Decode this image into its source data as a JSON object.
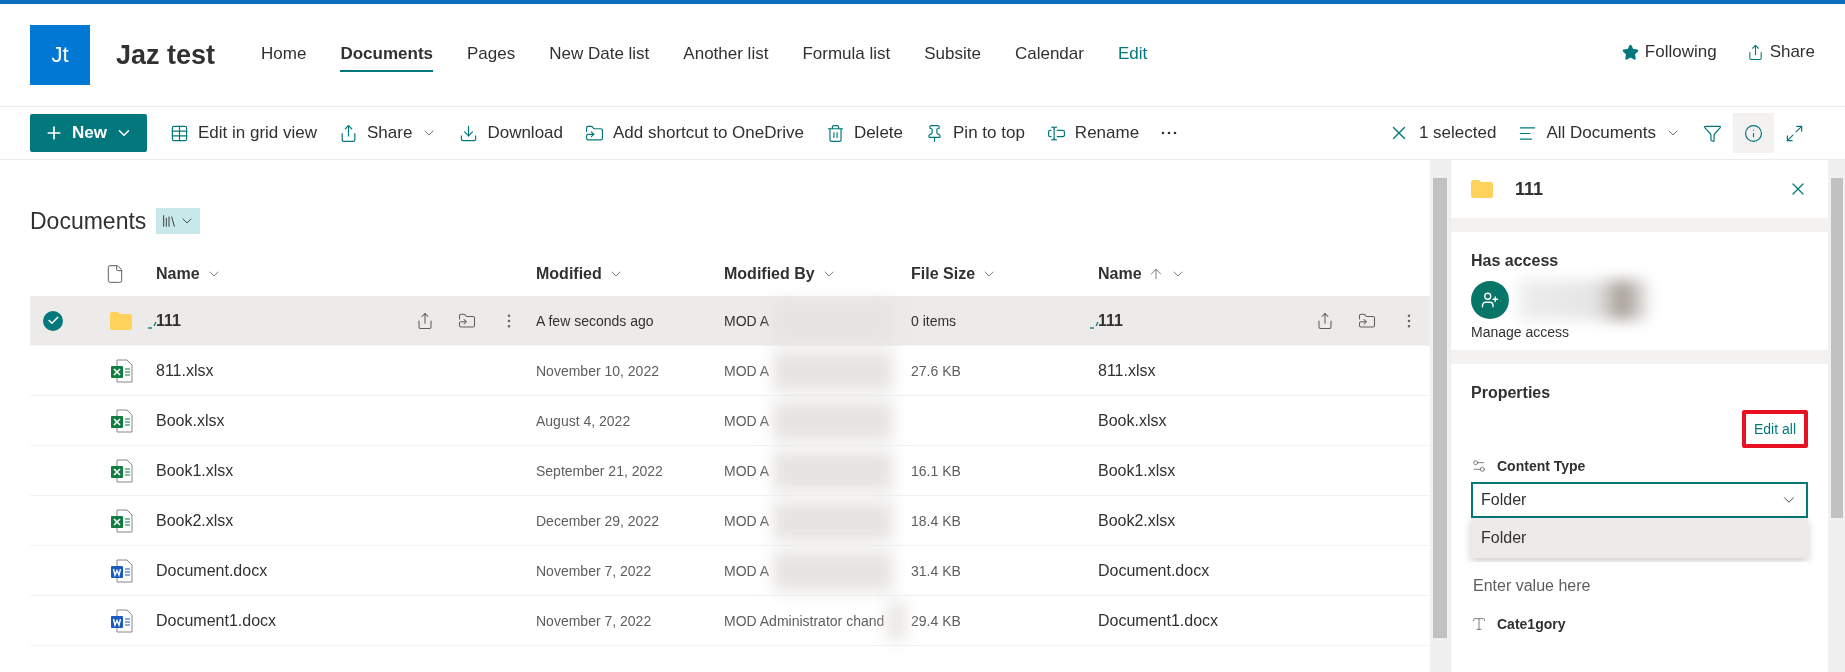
{
  "site": {
    "logo": "Jt",
    "title": "Jaz test"
  },
  "nav": [
    {
      "label": "Home",
      "kind": "tab",
      "selected": false
    },
    {
      "label": "Documents",
      "kind": "tab",
      "selected": true
    },
    {
      "label": "Pages",
      "kind": "tab",
      "selected": false
    },
    {
      "label": "New Date list",
      "kind": "tab",
      "selected": false
    },
    {
      "label": "Another list",
      "kind": "tab",
      "selected": false
    },
    {
      "label": "Formula list",
      "kind": "tab",
      "selected": false
    },
    {
      "label": "Subsite",
      "kind": "tab",
      "selected": false
    },
    {
      "label": "Calendar",
      "kind": "tab",
      "selected": false
    },
    {
      "label": "Edit",
      "kind": "edit",
      "selected": false
    }
  ],
  "header_actions": [
    {
      "label": "Following",
      "kind": "following"
    },
    {
      "label": "Share",
      "kind": "share"
    }
  ],
  "commands": [
    {
      "label": "New",
      "kind": "new",
      "dropdown": true
    },
    {
      "label": "Edit in grid view",
      "kind": "grid",
      "dropdown": false
    },
    {
      "label": "Share",
      "kind": "share",
      "dropdown": true
    },
    {
      "label": "Download",
      "kind": "download",
      "dropdown": false
    },
    {
      "label": "Add shortcut to OneDrive",
      "kind": "shortcut",
      "dropdown": false
    },
    {
      "label": "Delete",
      "kind": "delete",
      "dropdown": false
    },
    {
      "label": "Pin to top",
      "kind": "pin",
      "dropdown": false
    },
    {
      "label": "Rename",
      "kind": "rename",
      "dropdown": false
    },
    {
      "kind": "more",
      "dropdown": false
    }
  ],
  "commands_right": [
    {
      "label": "1 selected",
      "kind": "clear",
      "dropdown": false,
      "selected": false
    },
    {
      "label": "All Documents",
      "kind": "view",
      "dropdown": true,
      "selected": false
    },
    {
      "kind": "filter",
      "dropdown": false,
      "selected": false
    },
    {
      "kind": "info",
      "dropdown": false,
      "selected": true
    },
    {
      "kind": "expand",
      "dropdown": false,
      "selected": false
    }
  ],
  "library": {
    "title": "Documents"
  },
  "table": {
    "columns": [
      {
        "kind": "type"
      },
      {
        "label": "Name",
        "kind": "text",
        "sorted_ascending": false
      },
      {
        "label": "Modified",
        "kind": "text",
        "sorted_ascending": false
      },
      {
        "label": "Modified By",
        "kind": "text",
        "sorted_ascending": false
      },
      {
        "label": "File Size",
        "kind": "text",
        "sorted_ascending": false
      },
      {
        "label": "Name",
        "kind": "text",
        "sorted_ascending": true
      }
    ],
    "rows": [
      {
        "kind": "folder",
        "name": "111",
        "new": true,
        "selected": true,
        "modified": "A few seconds ago",
        "modified_by": "MOD A",
        "file_size": "0 items",
        "name_2": "111"
      },
      {
        "kind": "excel",
        "name": "811.xlsx",
        "new": false,
        "selected": false,
        "modified": "November 10, 2022",
        "modified_by": "MOD A",
        "file_size": "27.6 KB",
        "name_2": "811.xlsx"
      },
      {
        "kind": "excel",
        "name": "Book.xlsx",
        "new": false,
        "selected": false,
        "modified": "August 4, 2022",
        "modified_by": "MOD A",
        "name_2": "Book.xlsx"
      },
      {
        "kind": "excel",
        "name": "Book1.xlsx",
        "new": false,
        "selected": false,
        "modified": "September 21, 2022",
        "modified_by": "MOD A",
        "file_size": "16.1 KB",
        "name_2": "Book1.xlsx"
      },
      {
        "kind": "excel",
        "name": "Book2.xlsx",
        "new": false,
        "selected": false,
        "modified": "December 29, 2022",
        "modified_by": "MOD A",
        "file_size": "18.4 KB",
        "name_2": "Book2.xlsx"
      },
      {
        "kind": "word",
        "name": "Document.docx",
        "new": false,
        "selected": false,
        "modified": "November 7, 2022",
        "modified_by": "MOD A",
        "file_size": "31.4 KB",
        "name_2": "Document.docx"
      },
      {
        "kind": "word",
        "name": "Document1.docx",
        "new": false,
        "selected": false,
        "modified": "November 7, 2022",
        "modified_by": "MOD Administrator chand",
        "file_size": "29.4 KB",
        "name_2": "Document1.docx"
      }
    ]
  },
  "details_pane": {
    "title": "111",
    "has_access": {
      "heading": "Has access",
      "link": "Manage access"
    },
    "properties": {
      "heading": "Properties",
      "edit_all": "Edit all",
      "fields": [
        {
          "kind": "choice",
          "label": "Content Type",
          "value": "Folder",
          "expanded": true,
          "options": [
            "Folder"
          ]
        },
        {
          "kind": "text",
          "placeholder": "Enter value here"
        },
        {
          "kind": "text",
          "label": "Cate1gory"
        }
      ]
    }
  }
}
